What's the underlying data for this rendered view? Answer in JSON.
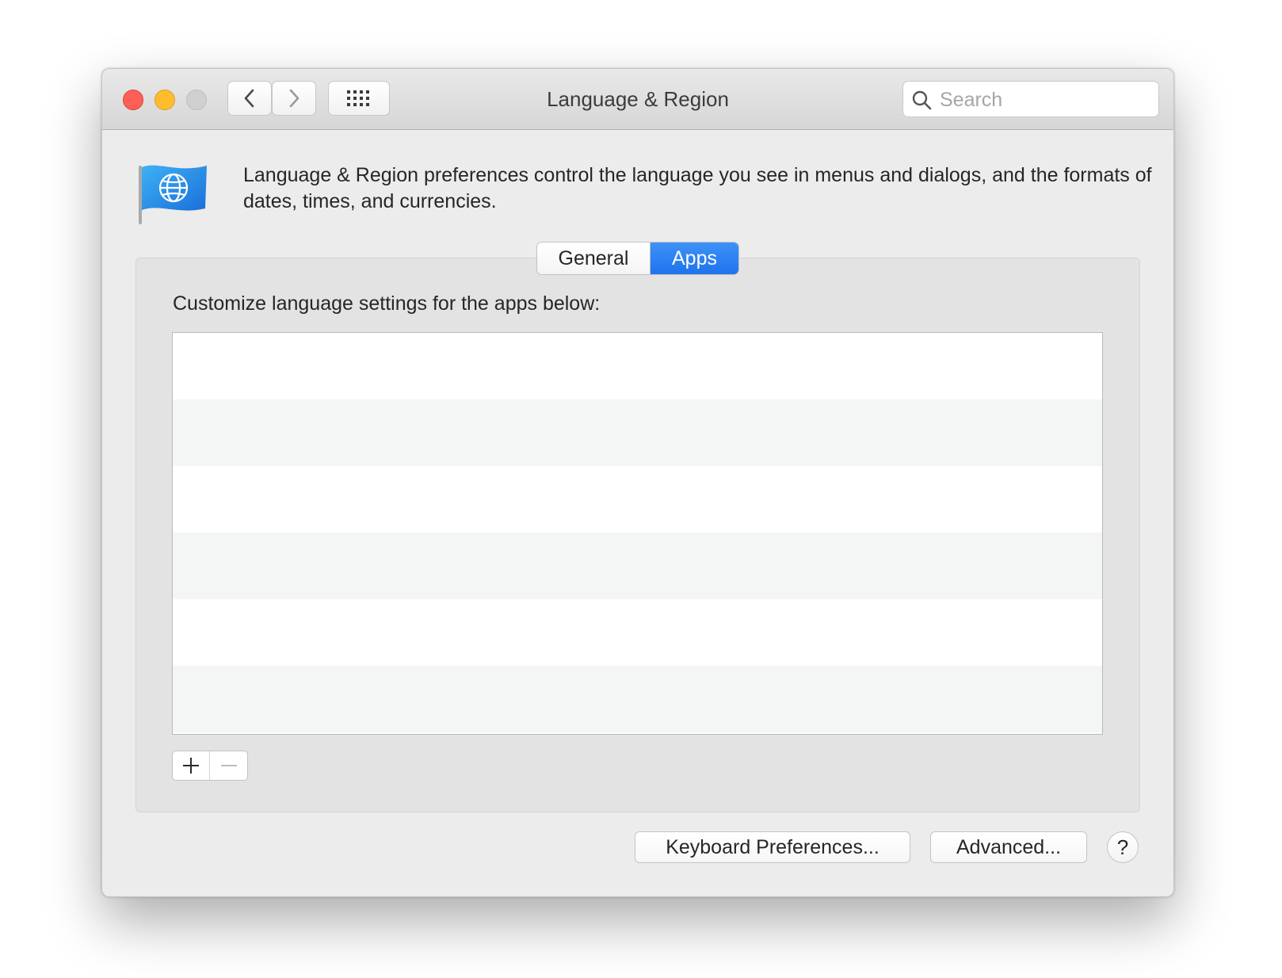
{
  "window": {
    "title": "Language & Region"
  },
  "toolbar": {
    "back_icon": "chevron-left-icon",
    "forward_icon": "chevron-right-icon",
    "grid_icon": "grid-icon"
  },
  "search": {
    "placeholder": "Search",
    "value": ""
  },
  "header": {
    "icon": "flag-globe-icon",
    "description": "Language & Region preferences control the language you see in menus and dialogs, and the formats of dates, times, and currencies."
  },
  "tabs": [
    {
      "label": "General",
      "selected": false
    },
    {
      "label": "Apps",
      "selected": true
    }
  ],
  "apps_panel": {
    "label": "Customize language settings for the apps below:",
    "rows": [],
    "add_icon": "plus-icon",
    "remove_icon": "minus-icon"
  },
  "buttons": {
    "keyboard": "Keyboard Preferences...",
    "advanced": "Advanced...",
    "help": "?"
  },
  "colors": {
    "accent": "#2a7ef2",
    "close": "#fe5f57",
    "minimize": "#febc2e",
    "zoom_disabled": "#d0d0d0"
  }
}
